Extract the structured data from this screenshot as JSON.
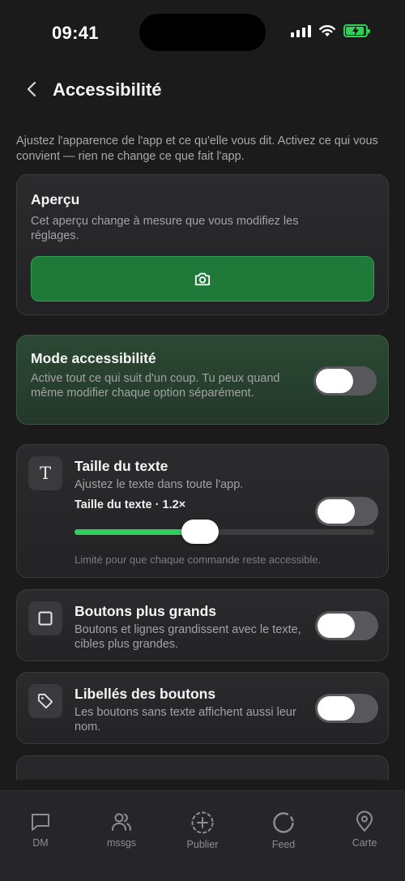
{
  "status": {
    "time": "09:41"
  },
  "header": {
    "title": "Accessibilité"
  },
  "intro": "Ajustez l'apparence de l'app et ce qu'elle vous dit. Activez ce qui vous convient — rien ne change ce que fait l'app.",
  "preview": {
    "title": "Aperçu",
    "description": "Cet aperçu change à mesure que vous modifiez les réglages.",
    "button_icon": "camera-icon",
    "accent": "#1f7a3a"
  },
  "accessibility_mode": {
    "title": "Mode accessibilité",
    "description": "Active tout ce qui suit d'un coup. Tu peux quand même modifier chaque option séparément.",
    "enabled": false
  },
  "text_size": {
    "icon": "text-T-icon",
    "title": "Taille du texte",
    "description": "Ajustez le texte dans toute l'app.",
    "slider_label": "Taille du texte · 1.2×",
    "enabled": false,
    "slider_fraction": 0.42,
    "note": "Limité pour que chaque commande reste accessible.",
    "slider_color": "#2fcf5c"
  },
  "larger_buttons": {
    "icon": "square-icon",
    "title": "Boutons plus grands",
    "description": "Boutons et lignes grandissent avec le texte, cibles plus grandes.",
    "enabled": false
  },
  "button_labels": {
    "icon": "tag-icon",
    "title": "Libellés des boutons",
    "description": "Les boutons sans texte affichent aussi leur nom.",
    "enabled": false
  },
  "tabbar": {
    "items": [
      {
        "label": "DM",
        "icon": "message-square-icon"
      },
      {
        "label": "mssgs",
        "icon": "users-icon"
      },
      {
        "label": "Publier",
        "icon": "plus-circle-icon"
      },
      {
        "label": "Feed",
        "icon": "circle-icon"
      },
      {
        "label": "Carte",
        "icon": "map-pin-icon"
      }
    ]
  }
}
